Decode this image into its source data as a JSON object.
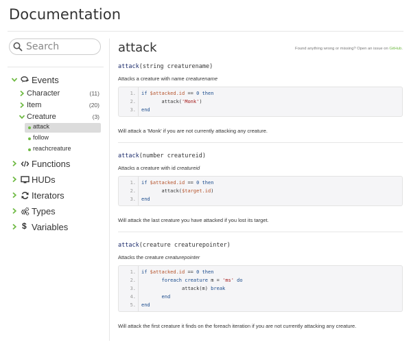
{
  "header": {
    "title": "Documentation"
  },
  "search": {
    "placeholder": "Search"
  },
  "nav": {
    "events": "Events",
    "character": {
      "label": "Character",
      "count": "(11)"
    },
    "item": {
      "label": "Item",
      "count": "(20)"
    },
    "creature": {
      "label": "Creature",
      "count": "(3)"
    },
    "leaves": [
      "attack",
      "follow",
      "reachcreature"
    ],
    "functions": "Functions",
    "huds": "HUDs",
    "iterators": "Iterators",
    "types": "Types",
    "variables": "Variables"
  },
  "main": {
    "title": "attack",
    "found_prefix": "Found anything wrong or missing? Open an issue on ",
    "found_link": "GitHub",
    "found_suffix": ".",
    "sections": [
      {
        "fn": "attack",
        "param_type": "string",
        "param_name": "creaturename",
        "desc_prefix": "Attacks a creature with name ",
        "desc_em": "creaturename",
        "lines": [
          "1.",
          "2.",
          "3."
        ],
        "after": "Will attack a 'Monk' if you are not currently attacking any creature."
      },
      {
        "fn": "attack",
        "param_type": "number",
        "param_name": "creatureid",
        "desc_prefix": "Attacks a creature with id ",
        "desc_em": "creatureid",
        "lines": [
          "1.",
          "2.",
          "3."
        ],
        "after": "Will attack the last creature you have attacked if you lost its target."
      },
      {
        "fn": "attack",
        "param_type": "creature",
        "param_name": "creaturepointer",
        "desc_prefix": "Attacks the creature ",
        "desc_em": "creaturepointer",
        "lines": [
          "1.",
          "2.",
          "3.",
          "4.",
          "5."
        ],
        "after": "Will attack the first creature it finds on the foreach iteration if you are not currently attacking any creature."
      }
    ],
    "code": {
      "if": "if",
      "attacked_id": "$attacked.id",
      "eq": "==",
      "zero": "0",
      "then": "then",
      "attack_call": "attack(",
      "monk": "'Monk'",
      "close": ")",
      "target_id": "$target.id",
      "end": "end",
      "foreach": "foreach",
      "creature": "creature",
      "m": "m",
      "equals": "=",
      "ms": "'ms'",
      "do": "do",
      "attack_m": "attack(m)",
      "break": "break"
    }
  },
  "colors": {
    "accent": "#6fba44",
    "title_fn": "#1a2a6a"
  },
  "icons": [
    "search-icon",
    "chevron-down-icon",
    "chevron-right-icon",
    "comments-icon",
    "code-icon",
    "monitor-icon",
    "refresh-icon",
    "cogs-icon",
    "dollar-icon"
  ]
}
